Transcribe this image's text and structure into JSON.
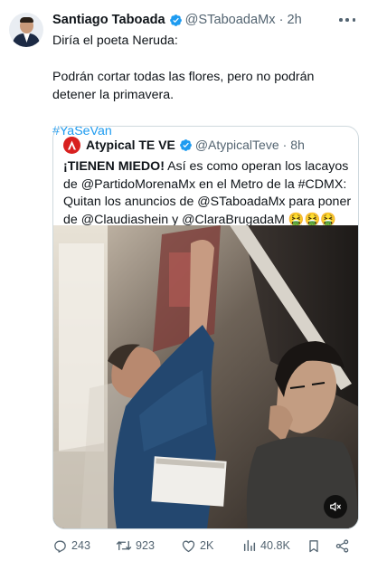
{
  "tweet": {
    "author_name": "Santiago Taboada",
    "author_handle": "@STaboadaMx",
    "time": "2h",
    "text_line1": "Diría el poeta Neruda:",
    "text_line2": "Podrán cortar todas las flores, pero no podrán detener la primavera.",
    "hashtag": "#YaSeVan"
  },
  "quote": {
    "author_name": "Atypical TE VE",
    "author_handle": "@AtypicalTeve",
    "time": "8h",
    "lead": "¡TIENEN MIEDO!",
    "text": " Así es como operan los lacayos de @PartidoMorenaMx en el Metro de la #CDMX: Quitan los anuncios de @STaboadaMx para poner de @Claudiashein y @ClaraBrugadaM 🤮🤮🤮"
  },
  "actions": {
    "replies": "243",
    "retweets": "923",
    "likes": "2K",
    "views": "40.8K"
  },
  "icons": {
    "verified": "verified-badge-icon",
    "more": "more-dots-icon",
    "reply": "reply-icon",
    "retweet": "retweet-icon",
    "like": "heart-icon",
    "views": "views-icon",
    "bookmark": "bookmark-icon",
    "share": "share-icon",
    "mute": "speaker-muted-icon"
  },
  "colors": {
    "link": "#1d9bf0",
    "secondary": "#536471",
    "verified": "#1d9bf0",
    "brand_red": "#d8201f"
  }
}
